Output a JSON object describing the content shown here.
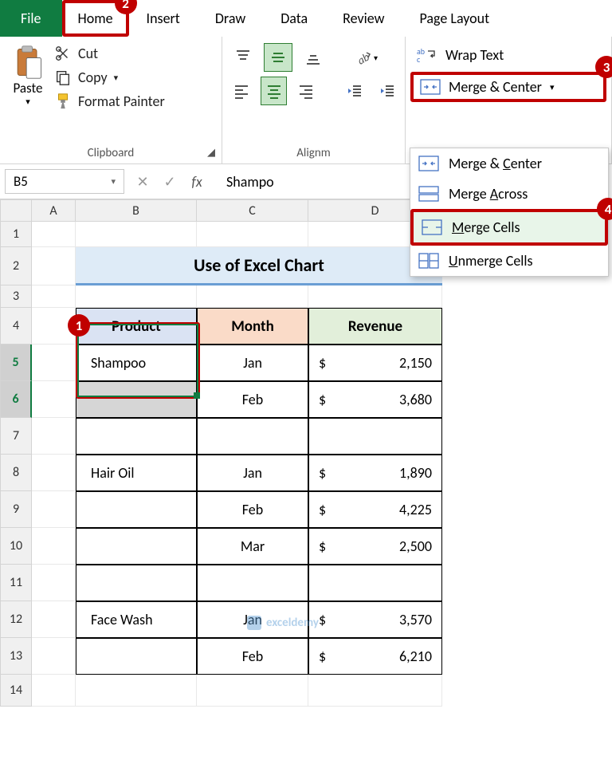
{
  "tabs": {
    "file": "File",
    "home": "Home",
    "insert": "Insert",
    "draw": "Draw",
    "data": "Data",
    "review": "Review",
    "page_layout": "Page Layout"
  },
  "clipboard": {
    "paste": "Paste",
    "cut": "Cut",
    "copy": "Copy",
    "format_painter": "Format Painter",
    "group_label": "Clipboard"
  },
  "alignment": {
    "group_label": "Alignm",
    "wrap_text": "Wrap Text",
    "merge_center": "Merge & Center"
  },
  "merge_menu": {
    "merge_center": "Merge & Center",
    "merge_across": "Merge Across",
    "merge_cells": "Merge Cells",
    "unmerge": "Unmerge Cells"
  },
  "formula_bar": {
    "namebox": "B5",
    "content": "Shampo"
  },
  "columns": [
    "A",
    "B",
    "C",
    "D"
  ],
  "rows": [
    "1",
    "2",
    "3",
    "4",
    "5",
    "6",
    "7",
    "8",
    "9",
    "10",
    "11",
    "12",
    "13",
    "14"
  ],
  "sheet": {
    "title": "Use of Excel Chart",
    "headers": {
      "product": "Product",
      "month": "Month",
      "revenue": "Revenue"
    },
    "data": [
      {
        "product": "Shampoo",
        "month": "Jan",
        "currency": "$",
        "revenue": "2,150"
      },
      {
        "product": "",
        "month": "Feb",
        "currency": "$",
        "revenue": "3,680"
      },
      {
        "product": "",
        "month": "",
        "currency": "",
        "revenue": ""
      },
      {
        "product": "Hair Oil",
        "month": "Jan",
        "currency": "$",
        "revenue": "1,890"
      },
      {
        "product": "",
        "month": "Feb",
        "currency": "$",
        "revenue": "4,225"
      },
      {
        "product": "",
        "month": "Mar",
        "currency": "$",
        "revenue": "2,500"
      },
      {
        "product": "",
        "month": "",
        "currency": "",
        "revenue": ""
      },
      {
        "product": "Face Wash",
        "month": "Jan",
        "currency": "$",
        "revenue": "3,570"
      },
      {
        "product": "",
        "month": "Feb",
        "currency": "$",
        "revenue": "6,210"
      }
    ]
  },
  "annotations": [
    "1",
    "2",
    "3",
    "4"
  ],
  "watermark": "exceldemy"
}
